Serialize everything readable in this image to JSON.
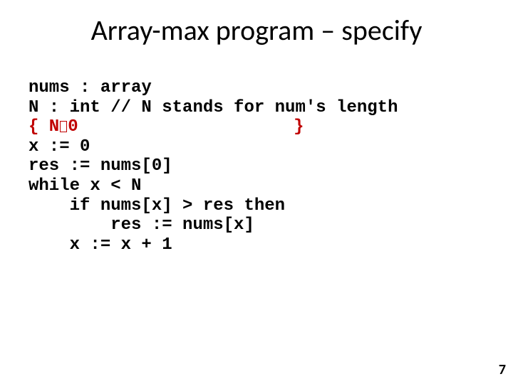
{
  "title": "Array-max program – specify",
  "code": {
    "l1": "nums : array",
    "l2": "N : int // N stands for num's length",
    "l3_open": "{ N",
    "l3_mid": "0",
    "l3_close": "                     }",
    "l4": "x := 0",
    "l5": "res := nums[0]",
    "l6": "while x < N",
    "l7": "    if nums[x] > res then",
    "l8": "        res := nums[x]",
    "l9": "    x := x + 1"
  },
  "page": "7"
}
